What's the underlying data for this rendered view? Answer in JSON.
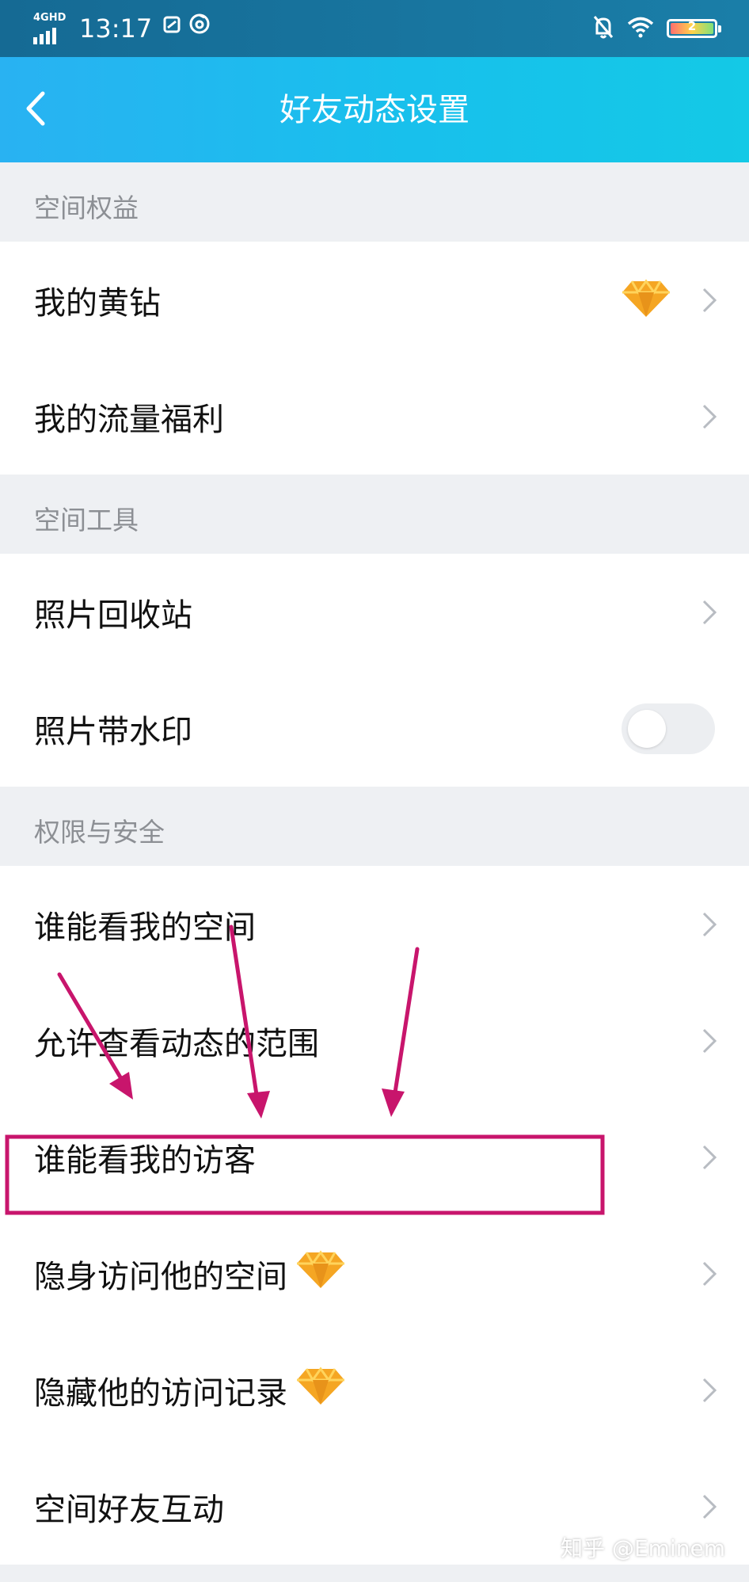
{
  "status_bar": {
    "network": "4GHD",
    "time": "13:17",
    "battery_level": "2"
  },
  "header": {
    "title": "好友动态设置"
  },
  "sections": [
    {
      "title": "空间权益",
      "items": [
        {
          "label": "我的黄钻"
        },
        {
          "label": "我的流量福利"
        }
      ]
    },
    {
      "title": "空间工具",
      "items": [
        {
          "label": "照片回收站"
        },
        {
          "label": "照片带水印",
          "toggle_on": false
        }
      ]
    },
    {
      "title": "权限与安全",
      "items": [
        {
          "label": "谁能看我的空间"
        },
        {
          "label": "允许查看动态的范围"
        },
        {
          "label": "谁能看我的访客"
        },
        {
          "label": "隐身访问他的空间"
        },
        {
          "label": "隐藏他的访问记录"
        },
        {
          "label": "空间好友互动"
        }
      ]
    }
  ],
  "watermark": "知乎 @Eminem",
  "colors": {
    "accent": "#1fb8ee",
    "annotation": "#c8156c",
    "diamond": "#f5a623"
  }
}
